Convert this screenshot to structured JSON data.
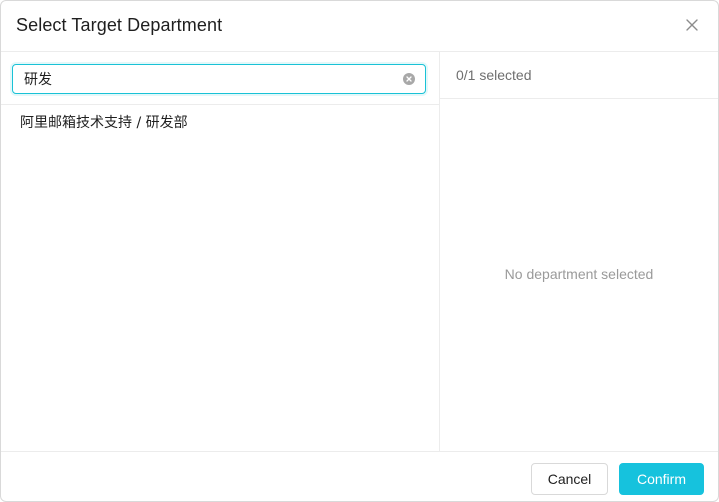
{
  "dialog": {
    "title": "Select Target Department",
    "close_icon": "close-icon"
  },
  "search": {
    "value": "研发",
    "clear_icon": "clear-circle-icon"
  },
  "results": [
    {
      "label": "阿里邮箱技术支持 / 研发部"
    }
  ],
  "selected": {
    "count_text": "0/1 selected",
    "empty_text": "No department selected"
  },
  "footer": {
    "cancel_label": "Cancel",
    "confirm_label": "Confirm"
  },
  "colors": {
    "accent": "#16c2dd",
    "border": "#ececec"
  }
}
